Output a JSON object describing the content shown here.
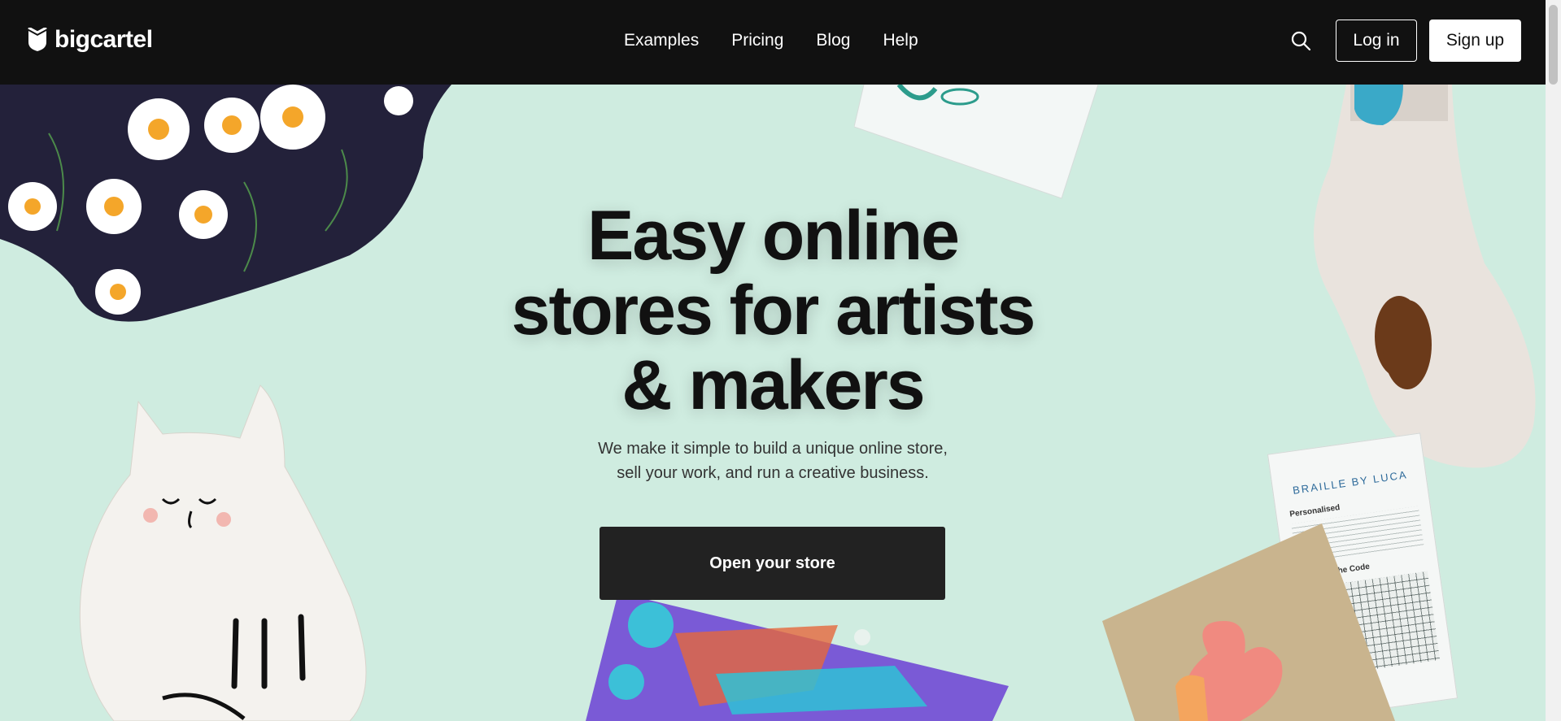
{
  "header": {
    "logo_text": "bigcartel",
    "nav": [
      "Examples",
      "Pricing",
      "Blog",
      "Help"
    ],
    "login_label": "Log in",
    "signup_label": "Sign up"
  },
  "hero": {
    "title_lines": [
      "Easy online",
      "stores for artists",
      "& makers"
    ],
    "subtitle_lines": [
      "We make it simple to build a unique online store,",
      "sell your work, and run a creative business."
    ],
    "cta_label": "Open your store"
  },
  "products": {
    "card_brand": "BRAILLE BY LUCA",
    "card_heading_1": "Personalised",
    "card_heading_2": "Cracking the Code"
  },
  "colors": {
    "header_bg": "#111111",
    "hero_bg": "#cfece0",
    "cta_bg": "#222222"
  }
}
